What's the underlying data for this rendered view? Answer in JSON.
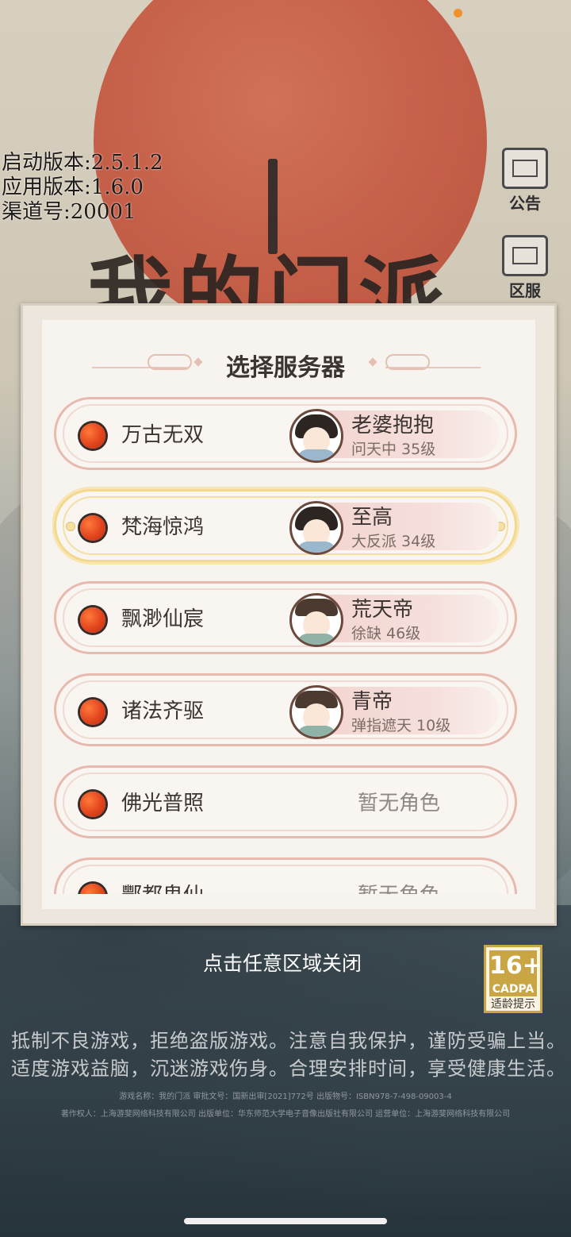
{
  "version_info": {
    "launch_version": "启动版本:2.5.1.2",
    "app_version": "应用版本:1.6.0",
    "channel": "渠道号:20001"
  },
  "game_logo": "我的门派",
  "side_buttons": {
    "announcement": "公告",
    "server": "区服"
  },
  "dialog": {
    "title": "选择服务器",
    "servers": [
      {
        "name": "万古无双",
        "character": "老婆抱抱",
        "detail": "问天中 35级",
        "selected": false,
        "avatar": "female"
      },
      {
        "name": "梵海惊鸿",
        "character": "至高",
        "detail": "大反派 34级",
        "selected": true,
        "avatar": "female"
      },
      {
        "name": "飘渺仙宸",
        "character": "荒天帝",
        "detail": "徐缺 46级",
        "selected": false,
        "avatar": "male"
      },
      {
        "name": "诸法齐驱",
        "character": "青帝",
        "detail": "弹指遮天 10级",
        "selected": false,
        "avatar": "male"
      },
      {
        "name": "佛光普照",
        "character": "",
        "detail": "",
        "empty_label": "暂无角色",
        "selected": false
      },
      {
        "name": "酆都鬼仙",
        "character": "",
        "detail": "",
        "empty_label": "暂无角色",
        "selected": false
      }
    ]
  },
  "close_hint": "点击任意区域关闭",
  "age_rating": {
    "age": "16+",
    "org": "CADPA",
    "label": "适龄提示"
  },
  "health_notice": {
    "line1": "抵制不良游戏，拒绝盗版游戏。注意自我保护，谨防受骗上当。",
    "line2": "适度游戏益脑，沉迷游戏伤身。合理安排时间，享受健康生活。"
  },
  "publish_info": {
    "line1": "游戏名称：我的门派 审批文号：国新出审[2021]772号 出版物号：ISBN978-7-498-09003-4",
    "line2": "著作权人：上海游斐网络科技有限公司 出版单位：华东师范大学电子音像出版社有限公司 运营单位：上海游斐网络科技有限公司"
  }
}
